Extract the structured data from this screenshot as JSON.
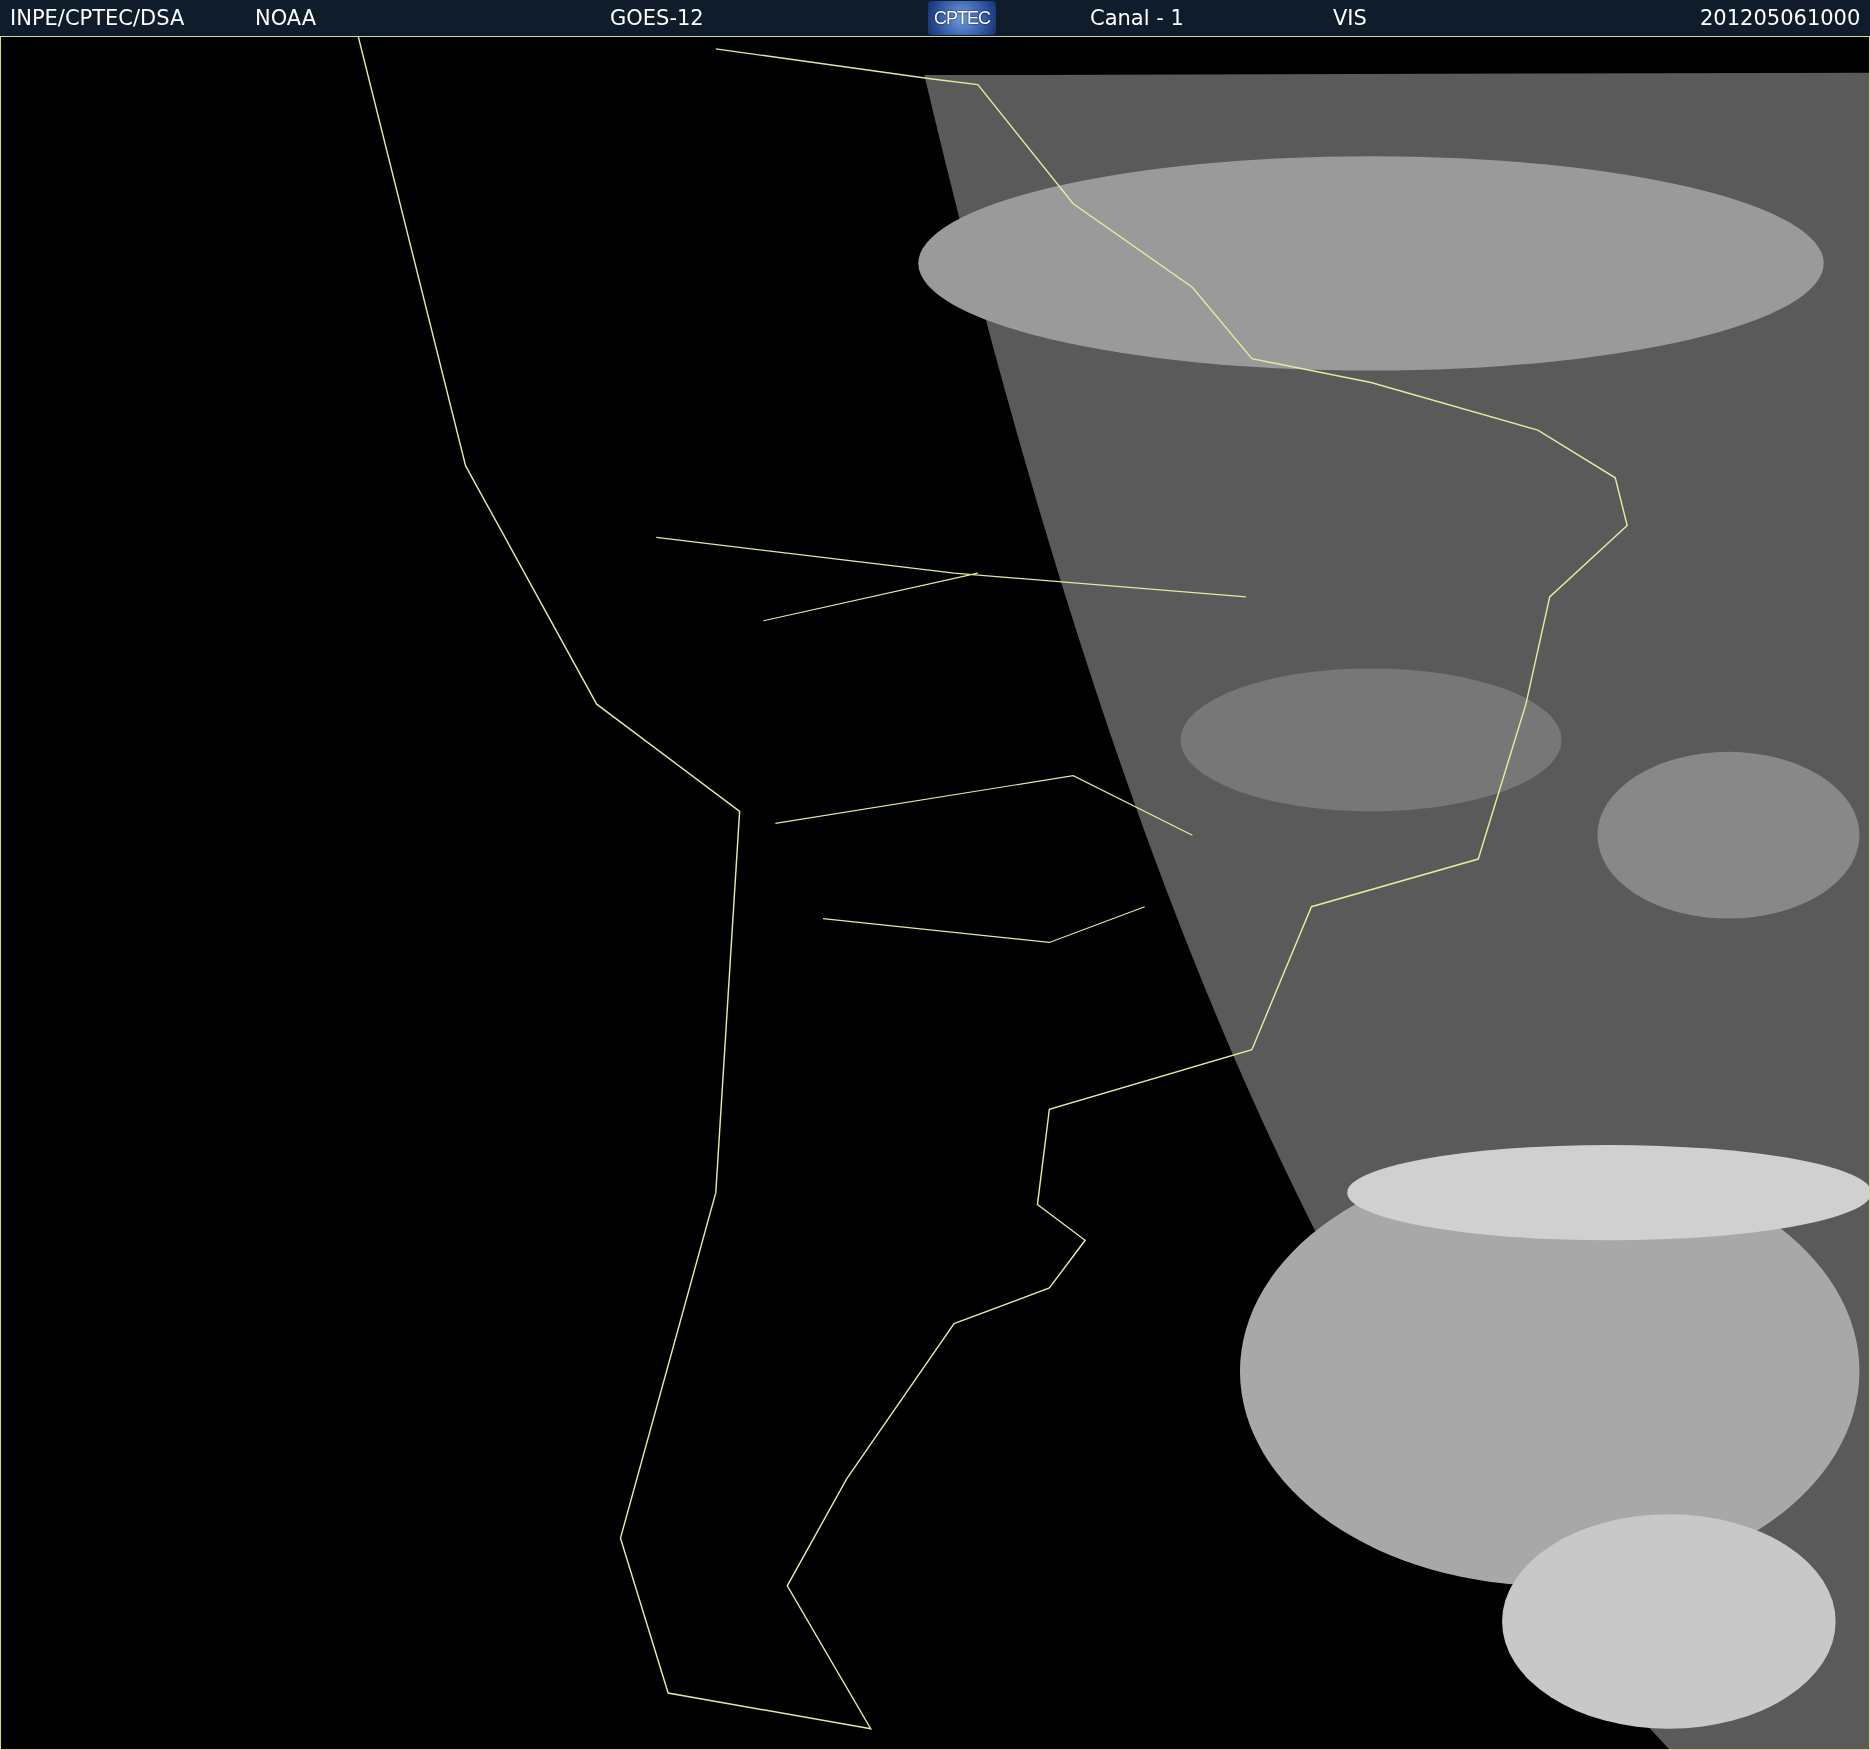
{
  "header": {
    "items": [
      {
        "kind": "text",
        "text": "INPE/CPTEC/DSA"
      },
      {
        "kind": "text",
        "text": "NOAA"
      },
      {
        "kind": "text",
        "text": "GOES-12"
      },
      {
        "kind": "logo",
        "text": "CPTEC"
      },
      {
        "kind": "text",
        "text": "Canal - 1"
      },
      {
        "kind": "text",
        "text": "VIS"
      },
      {
        "kind": "text",
        "text": "201205061000"
      }
    ]
  }
}
